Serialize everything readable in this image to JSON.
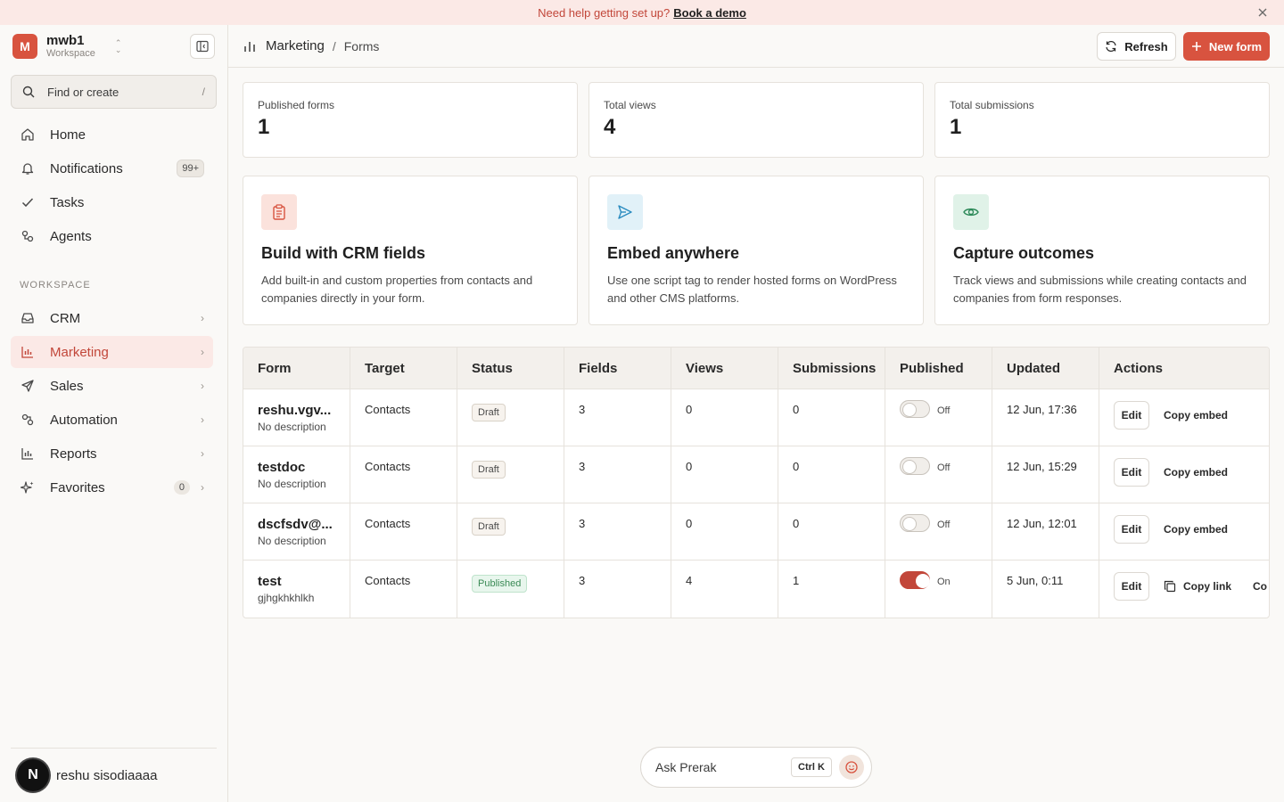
{
  "banner": {
    "text": "Need help getting set up?",
    "link": "Book a demo"
  },
  "workspace": {
    "initial": "M",
    "name": "mwb1",
    "subtitle": "Workspace"
  },
  "search": {
    "placeholder": "Find or create",
    "shortcut": "/"
  },
  "nav_top": [
    {
      "label": "Home",
      "icon": "home-icon"
    },
    {
      "label": "Notifications",
      "icon": "bell-icon",
      "badge": "99+"
    },
    {
      "label": "Tasks",
      "icon": "check-icon"
    },
    {
      "label": "Agents",
      "icon": "agents-icon"
    }
  ],
  "section_label": "WORKSPACE",
  "nav_workspace": [
    {
      "label": "CRM",
      "icon": "inbox-icon"
    },
    {
      "label": "Marketing",
      "icon": "bar-chart-icon",
      "active": true
    },
    {
      "label": "Sales",
      "icon": "send-icon"
    },
    {
      "label": "Automation",
      "icon": "automation-icon"
    },
    {
      "label": "Reports",
      "icon": "reports-icon"
    },
    {
      "label": "Favorites",
      "icon": "sparkle-icon",
      "badge": "0"
    }
  ],
  "user": {
    "initial": "N",
    "name": "reshu sisodiaaaa"
  },
  "header": {
    "crumb1": "Marketing",
    "separator": "/",
    "crumb2": "Forms",
    "refresh_label": "Refresh",
    "new_label": "New form"
  },
  "stats": [
    {
      "title": "Published forms",
      "value": "1"
    },
    {
      "title": "Total views",
      "value": "4"
    },
    {
      "title": "Total submissions",
      "value": "1"
    }
  ],
  "features": [
    {
      "title": "Build with CRM fields",
      "desc": "Add built-in and custom properties from contacts and companies directly in your form.",
      "icon": "clipboard-icon"
    },
    {
      "title": "Embed anywhere",
      "desc": "Use one script tag to render hosted forms on WordPress and other CMS platforms.",
      "icon": "send-icon"
    },
    {
      "title": "Capture outcomes",
      "desc": "Track views and submissions while creating contacts and companies from form responses.",
      "icon": "eye-icon"
    }
  ],
  "table": {
    "columns": [
      "Form",
      "Target",
      "Status",
      "Fields",
      "Views",
      "Submissions",
      "Published",
      "Updated",
      "Actions"
    ],
    "rows": [
      {
        "name": "reshu.vgv...",
        "desc": "No description",
        "target": "Contacts",
        "status": "Draft",
        "fields": "3",
        "views": "0",
        "submissions": "0",
        "published": "Off",
        "updated": "12 Jun, 17:36",
        "edit": "Edit",
        "action2": "Copy embed"
      },
      {
        "name": "testdoc",
        "desc": "No description",
        "target": "Contacts",
        "status": "Draft",
        "fields": "3",
        "views": "0",
        "submissions": "0",
        "published": "Off",
        "updated": "12 Jun, 15:29",
        "edit": "Edit",
        "action2": "Copy embed"
      },
      {
        "name": "dscfsdv@...",
        "desc": "No description",
        "target": "Contacts",
        "status": "Draft",
        "fields": "3",
        "views": "0",
        "submissions": "0",
        "published": "Off",
        "updated": "12 Jun, 12:01",
        "edit": "Edit",
        "action2": "Copy embed"
      },
      {
        "name": "test",
        "desc": "gjhgkhkhlkh",
        "target": "Contacts",
        "status": "Published",
        "fields": "3",
        "views": "4",
        "submissions": "1",
        "published": "On",
        "updated": "5 Jun, 0:11",
        "edit": "Edit",
        "action2": "Copy link",
        "action3": "Co"
      }
    ]
  },
  "ask": {
    "label": "Ask Prerak",
    "shortcut": "Ctrl K"
  },
  "colors": {
    "accent": "#d8533f",
    "accent_text": "#c2473a",
    "active_bg": "#fbe9e6"
  }
}
